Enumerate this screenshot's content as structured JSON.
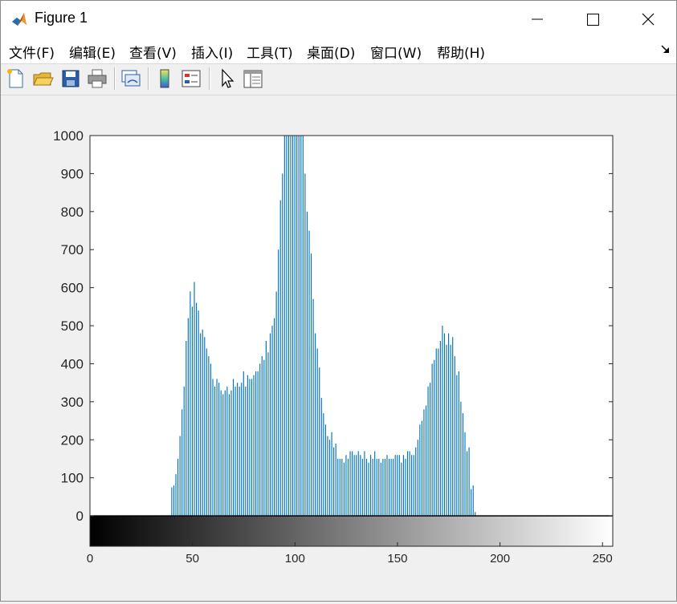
{
  "window": {
    "title": "Figure 1",
    "icons": {
      "app": "matlab-logo-icon",
      "minimize": "minimize-icon",
      "maximize": "maximize-icon",
      "close": "close-icon"
    }
  },
  "menu": {
    "items": [
      "文件(F)",
      "编辑(E)",
      "查看(V)",
      "插入(I)",
      "工具(T)",
      "桌面(D)",
      "窗口(W)",
      "帮助(H)"
    ]
  },
  "toolbar": {
    "buttons": [
      "new-figure-icon",
      "open-file-icon",
      "save-icon",
      "print-icon",
      "link-plot-icon",
      "insert-colorbar-icon",
      "insert-legend-icon",
      "edit-plot-icon",
      "property-inspector-icon"
    ]
  },
  "colors": {
    "bar": "#0072bd",
    "axes_bg": "#ffffff",
    "window_bg": "#f0f0f0"
  },
  "chart_data": {
    "type": "bar",
    "title": "",
    "xlabel": "",
    "ylabel": "",
    "xlim": [
      0,
      255
    ],
    "ylim": [
      -80,
      1000
    ],
    "xticks": [
      0,
      50,
      100,
      150,
      200,
      250
    ],
    "yticks": [
      0,
      100,
      200,
      300,
      400,
      500,
      600,
      700,
      800,
      900,
      1000
    ],
    "colorbar": "gray",
    "x_start": 40,
    "values": [
      75,
      80,
      110,
      150,
      210,
      280,
      340,
      460,
      520,
      590,
      550,
      615,
      560,
      540,
      480,
      490,
      470,
      440,
      420,
      400,
      360,
      340,
      360,
      350,
      330,
      320,
      330,
      340,
      320,
      330,
      360,
      340,
      350,
      340,
      350,
      380,
      340,
      370,
      360,
      360,
      370,
      380,
      380,
      400,
      420,
      410,
      460,
      430,
      480,
      500,
      520,
      590,
      700,
      830,
      900,
      1000,
      1000,
      1000,
      1000,
      1000,
      1000,
      1000,
      1000,
      1000,
      1000,
      900,
      800,
      750,
      690,
      570,
      480,
      440,
      390,
      310,
      270,
      240,
      210,
      200,
      220,
      180,
      190,
      150,
      150,
      150,
      140,
      160,
      150,
      170,
      170,
      160,
      160,
      170,
      160,
      150,
      170,
      150,
      140,
      160,
      150,
      170,
      150,
      150,
      140,
      150,
      150,
      160,
      150,
      150,
      150,
      160,
      160,
      160,
      140,
      160,
      150,
      170,
      170,
      160,
      160,
      180,
      200,
      240,
      250,
      280,
      290,
      340,
      350,
      400,
      410,
      440,
      440,
      460,
      500,
      480,
      450,
      480,
      450,
      470,
      420,
      370,
      380,
      300,
      270,
      220,
      170,
      180,
      70,
      80,
      10
    ]
  }
}
